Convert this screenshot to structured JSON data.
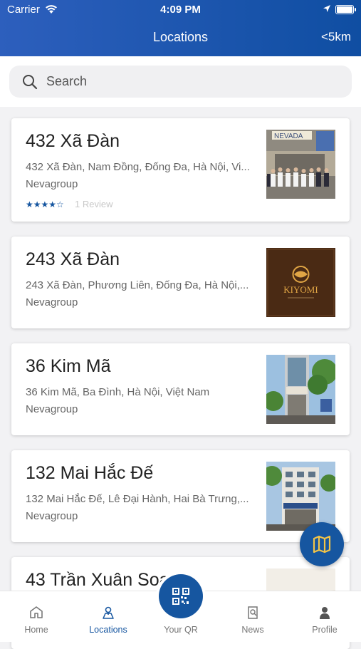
{
  "status": {
    "carrier": "Carrier",
    "time": "4:09 PM"
  },
  "header": {
    "title": "Locations",
    "filter": "<5km"
  },
  "search": {
    "placeholder": "Search"
  },
  "locations": [
    {
      "name": "432 Xã Đàn",
      "address": "432 Xã Đàn, Nam Đồng, Đống Đa, Hà Nội, Vi...",
      "group": "Nevagroup",
      "rating": 4,
      "reviews": "1 Review",
      "image": "building-staff-photo"
    },
    {
      "name": "243 Xã Đàn",
      "address": "243 Xã Đàn, Phương Liên, Đống Đa, Hà Nội,...",
      "group": "Nevagroup",
      "image": "kiyomi-logo",
      "logo_text": "KIYOMI"
    },
    {
      "name": "36 Kim Mã",
      "address": "36 Kim Mã, Ba Đình, Hà Nội, Việt Nam",
      "group": "Nevagroup",
      "image": "storefront-photo"
    },
    {
      "name": "132 Mai Hắc Đế",
      "address": "132 Mai Hắc Đế, Lê Đại Hành, Hai Bà Trưng,...",
      "group": "Nevagroup",
      "image": "building-photo"
    },
    {
      "name": "43 Trần Xuân Soạn",
      "image": "interior-photo"
    }
  ],
  "tabs": [
    {
      "label": "Home",
      "icon": "home-icon",
      "active": false
    },
    {
      "label": "Locations",
      "icon": "location-icon",
      "active": true
    },
    {
      "label": "Your QR",
      "icon": "qr-icon",
      "active": false
    },
    {
      "label": "News",
      "icon": "news-icon",
      "active": false
    },
    {
      "label": "Profile",
      "icon": "profile-icon",
      "active": false
    }
  ],
  "colors": {
    "primary": "#1656a0",
    "header_start": "#2d5fbd",
    "header_end": "#0f4ea2"
  }
}
